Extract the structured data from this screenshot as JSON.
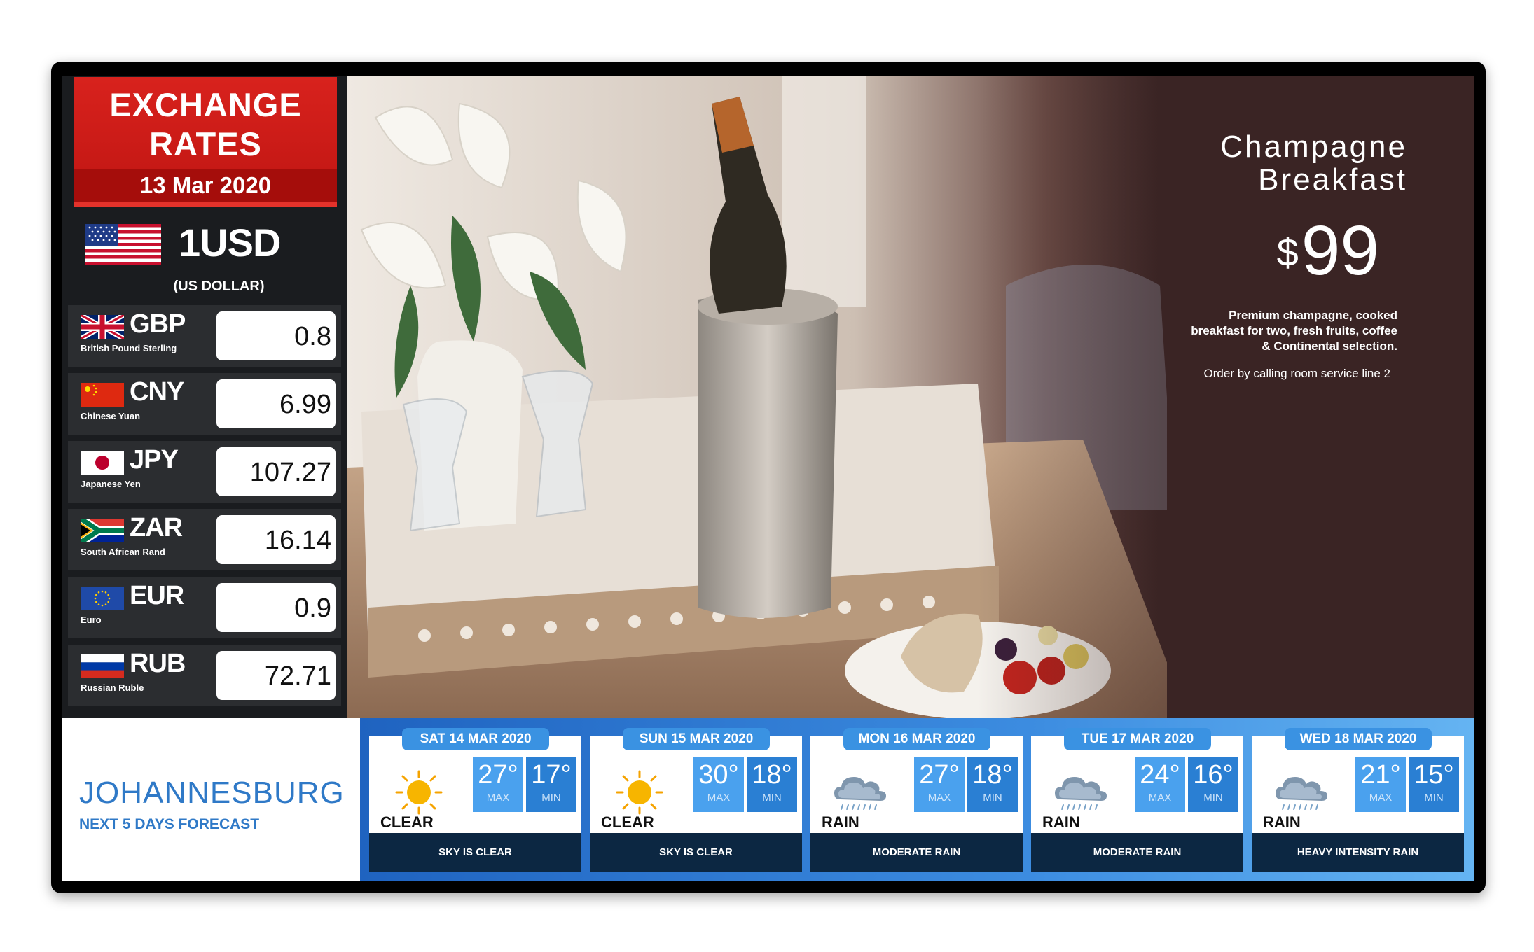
{
  "exchange": {
    "title_line1": "EXCHANGE",
    "title_line2": "RATES",
    "date": "13 Mar 2020",
    "base_code": "1USD",
    "base_name": "(US DOLLAR)",
    "rates": [
      {
        "code": "GBP",
        "name": "British Pound Sterling",
        "value": "0.8",
        "flag_icon": "uk-flag-icon"
      },
      {
        "code": "CNY",
        "name": "Chinese Yuan",
        "value": "6.99",
        "flag_icon": "china-flag-icon"
      },
      {
        "code": "JPY",
        "name": "Japanese Yen",
        "value": "107.27",
        "flag_icon": "japan-flag-icon"
      },
      {
        "code": "ZAR",
        "name": "South African Rand",
        "value": "16.14",
        "flag_icon": "south-africa-flag-icon"
      },
      {
        "code": "EUR",
        "name": "Euro",
        "value": "0.9",
        "flag_icon": "eu-flag-icon"
      },
      {
        "code": "RUB",
        "name": "Russian Ruble",
        "value": "72.71",
        "flag_icon": "russia-flag-icon"
      }
    ]
  },
  "promo": {
    "title_line1": "Champagne",
    "title_line2": "Breakfast",
    "currency": "$",
    "price": "99",
    "desc_line1": "Premium champagne, cooked",
    "desc_line2": "breakfast for two, fresh fruits, coffee",
    "desc_line3": "& Continental selection.",
    "order": "Order by calling room service line 2"
  },
  "weather": {
    "city": "JOHANNESBURG",
    "subtitle": "NEXT 5 DAYS FORECAST",
    "max_label": "MAX",
    "min_label": "MIN",
    "days": [
      {
        "date": "SAT 14 MAR 2020",
        "max": "27°",
        "min": "17°",
        "condition": "CLEAR",
        "description": "SKY IS CLEAR",
        "icon": "sun-icon"
      },
      {
        "date": "SUN 15 MAR 2020",
        "max": "30°",
        "min": "18°",
        "condition": "CLEAR",
        "description": "SKY IS CLEAR",
        "icon": "sun-icon"
      },
      {
        "date": "MON 16 MAR 2020",
        "max": "27°",
        "min": "18°",
        "condition": "RAIN",
        "description": "MODERATE RAIN",
        "icon": "rain-cloud-icon"
      },
      {
        "date": "TUE 17 MAR 2020",
        "max": "24°",
        "min": "16°",
        "condition": "RAIN",
        "description": "MODERATE RAIN",
        "icon": "rain-cloud-icon"
      },
      {
        "date": "WED 18 MAR 2020",
        "max": "21°",
        "min": "15°",
        "condition": "RAIN",
        "description": "HEAVY INTENSITY RAIN",
        "icon": "rain-cloud-icon"
      }
    ]
  },
  "colors": {
    "header_red": "#d8221d",
    "panel_dark": "#1a1c1f",
    "promo_brown": "#3a2424",
    "weather_blue": "#2f79c7",
    "desc_navy": "#0c2742"
  }
}
